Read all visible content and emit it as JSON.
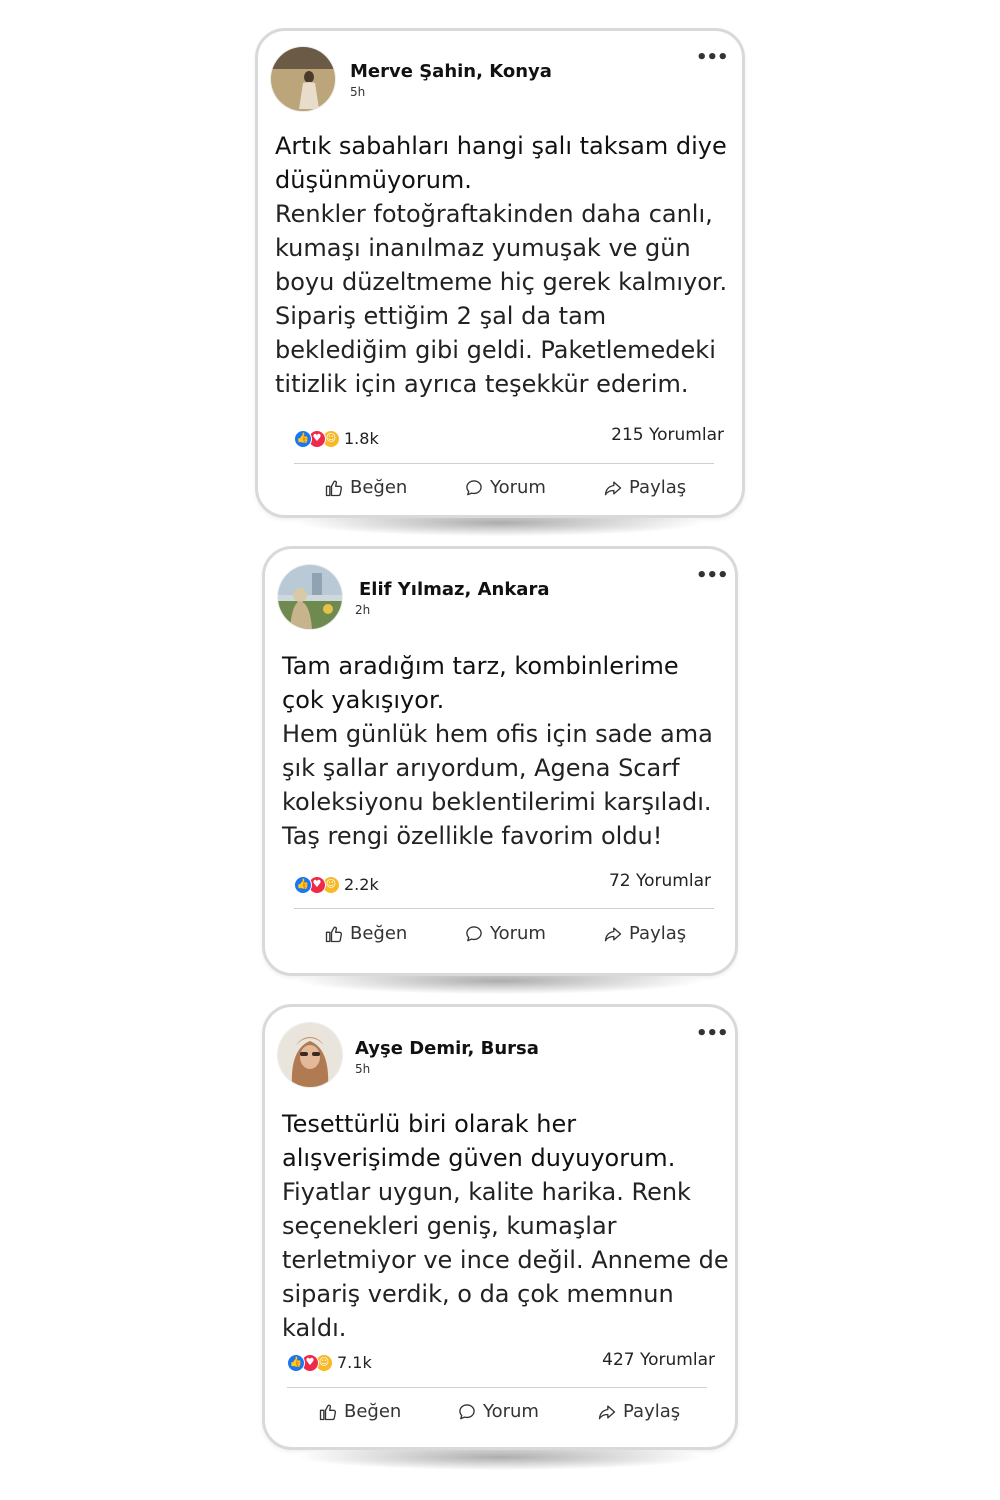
{
  "posts": [
    {
      "author": "Merve Şahin, Konya",
      "time": "5h",
      "headline": "Artık sabahları hangi şalı taksam diye düşünmüyorum.",
      "body": "Renkler fotoğraftakinden daha canlı, kumaşı inanılmaz yumuşak ve gün boyu düzeltmeme hiç gerek kalmıyor. Sipariş ettiğim 2 şal da tam beklediğim gibi geldi. Paketlemedeki titizlik için ayrıca teşekkür ederim.",
      "reactions": "1.8k",
      "comments": "215 Yorumlar"
    },
    {
      "author": "Elif Yılmaz, Ankara",
      "time": "2h",
      "headline": "Tam aradığım tarz, kombinlerime çok yakışıyor.",
      "body": "Hem günlük hem ofis için sade ama şık şallar arıyordum, Agena Scarf koleksiyonu beklentilerimi karşıladı. Taş rengi özellikle favorim oldu!",
      "reactions": "2.2k",
      "comments": "72 Yorumlar"
    },
    {
      "author": "Ayşe Demir, Bursa",
      "time": "5h",
      "headline": "Tesettürlü biri olarak her alışverişimde güven duyuyorum.",
      "body": "Fiyatlar uygun, kalite harika. Renk seçenekleri geniş, kumaşlar terletmiyor ve ince değil. Anneme de sipariş verdik, o da çok memnun kaldı.",
      "reactions": "7.1k",
      "comments": "427 Yorumlar"
    }
  ],
  "actions": {
    "like": "Beğen",
    "comment": "Yorum",
    "share": "Paylaş"
  },
  "more_label": "•••",
  "icons": [
    "more-options-icon",
    "like-reaction-icon",
    "love-reaction-icon",
    "care-reaction-icon",
    "thumbs-up-icon",
    "comment-bubble-icon",
    "share-arrow-icon"
  ],
  "colors": {
    "like": "#1877f2",
    "love": "#f02849",
    "care": "#f7b928",
    "border": "#d9d9d9"
  }
}
